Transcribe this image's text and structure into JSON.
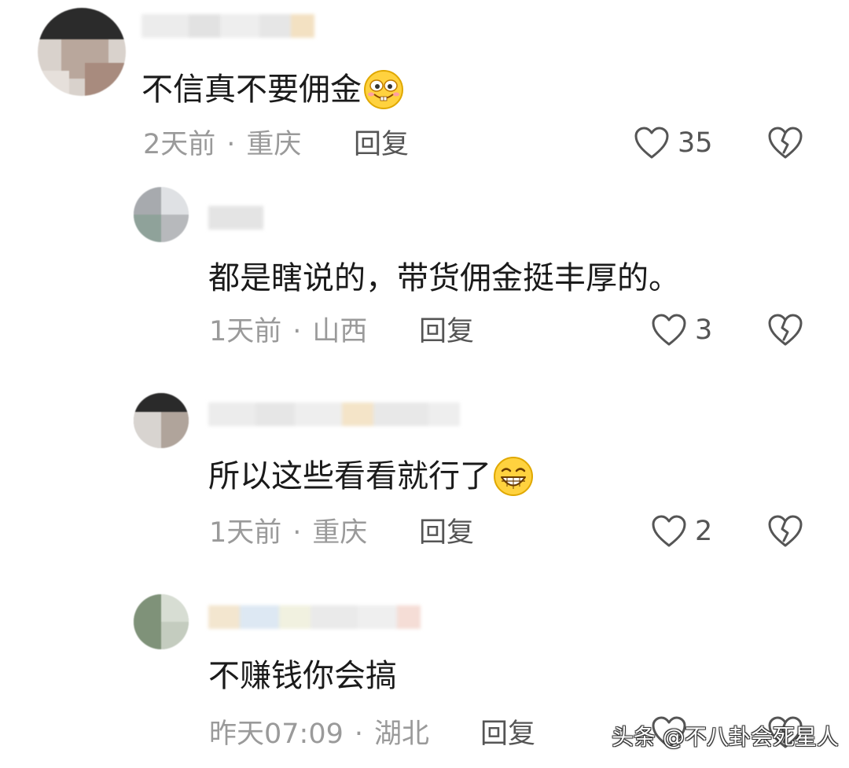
{
  "comments": [
    {
      "text": "不信真不要佣金",
      "emoji": "grinning-buck-teeth-emoji",
      "time": "2天前",
      "separator": "·",
      "location": "重庆",
      "reply_label": "回复",
      "likes": "35"
    },
    {
      "text": "都是瞎说的，带货佣金挺丰厚的。",
      "time": "1天前",
      "separator": "·",
      "location": "山西",
      "reply_label": "回复",
      "likes": "3"
    },
    {
      "text": "所以这些看看就行了",
      "emoji": "big-grin-emoji",
      "time": "1天前",
      "separator": "·",
      "location": "重庆",
      "reply_label": "回复",
      "likes": "2"
    },
    {
      "text": "不赚钱你会搞",
      "time": "昨天07:09",
      "separator": "·",
      "location": "湖北",
      "reply_label": "回复",
      "likes": ""
    }
  ],
  "watermark": "头条 @不八卦会死星人",
  "icons": {
    "like": "heart-outline-icon",
    "dislike": "broken-heart-icon"
  },
  "colors": {
    "text": "#1a1a1a",
    "meta": "#9a9a9a",
    "action": "#555555",
    "emoji_yellow": "#ffd23f"
  }
}
